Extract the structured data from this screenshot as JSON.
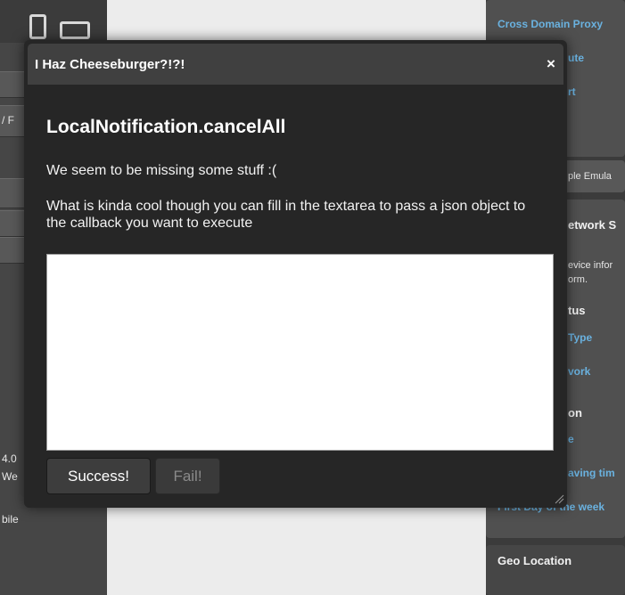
{
  "left_sidebar": {
    "line1": "/ F",
    "line2": "4.0",
    "line3": "We",
    "line4": "bile"
  },
  "right_sidebar": {
    "cross_domain_proxy": "Cross Domain Proxy",
    "route_partial": "ute",
    "port_partial": "rt",
    "emulator_partial": "ple Emula",
    "network_partial": "etwork S",
    "device_info_partial1": "evice infor",
    "device_info_partial2": "orm.",
    "status_partial": "tus",
    "type_partial": "Type",
    "network_item_partial": "vork",
    "on_partial": "on",
    "e_partial": "e",
    "saving_partial": "aving tim",
    "first_day_partial": "First Day of the week",
    "geo_location": "Geo Location"
  },
  "modal": {
    "title": "I Haz Cheeseburger?!?!",
    "close_label": "×",
    "heading": "LocalNotification.cancelAll",
    "message": "We seem to be missing some stuff :(",
    "description": "What is kinda cool though you can fill in the textarea to pass a json object to the callback you want to execute",
    "textarea_value": "",
    "success_label": "Success!",
    "fail_label": "Fail!"
  }
}
